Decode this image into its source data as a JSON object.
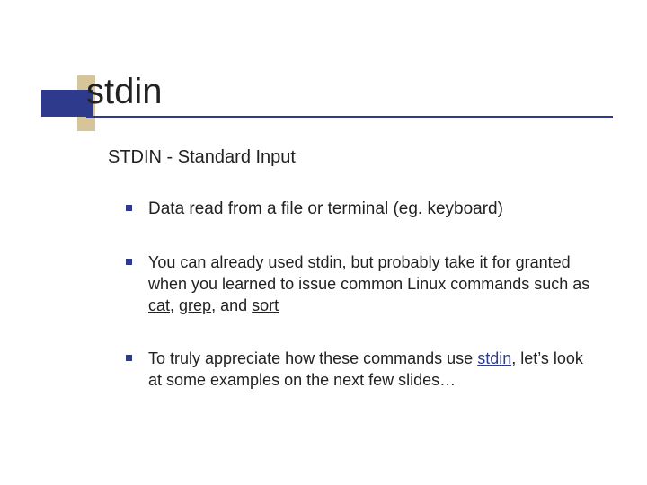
{
  "title": "stdin",
  "subtitle": "STDIN - Standard Input",
  "bullets": {
    "b1": {
      "text": "Data read from a file or terminal (eg. keyboard)"
    },
    "b2": {
      "pre": "You can already used stdin, but probably take it for granted when you learned to issue common Linux commands such as ",
      "cat": "cat",
      "sep1": ", ",
      "grep": "grep",
      "sep2": ", and ",
      "sort": "sort"
    },
    "b3": {
      "pre": "To truly appreciate how these commands use ",
      "stdin": "stdin",
      "post": ", let’s look at some examples on the next few slides…"
    }
  }
}
